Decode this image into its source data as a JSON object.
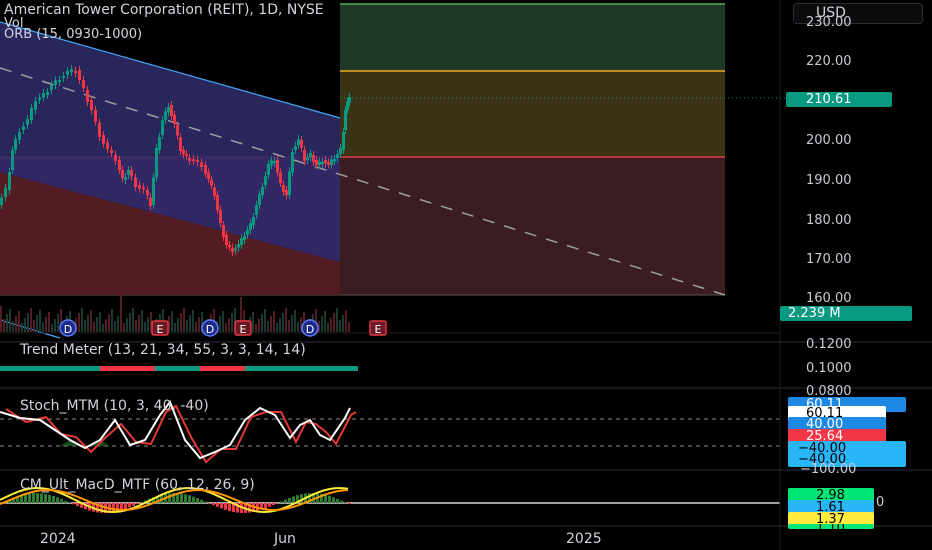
{
  "header": {
    "symbol_title": "American Tower Corporation (REIT), 1D, NYSE",
    "vol_label": "Vol",
    "orb_label": "ORB (15, 0930-1000)",
    "currency": "USD"
  },
  "price_axis": {
    "ticks": [
      "230.00",
      "220.00",
      "210.00",
      "200.00",
      "190.00",
      "180.00",
      "170.00",
      "160.00"
    ],
    "last_price": "210.61",
    "volume_badge": "2.239 M"
  },
  "trend_meter": {
    "title": "Trend Meter (13, 21, 34, 55, 3, 3, 14, 14)",
    "ticks": [
      "0.1200",
      "0.1000",
      "0.0800"
    ]
  },
  "stoch_mtm": {
    "title": "Stoch_MTM (10, 3, 40, -40)",
    "badges": [
      "60.11",
      "60.11",
      "40.00",
      "25.64",
      "−40.00",
      "−40.00",
      "−100.00"
    ]
  },
  "macd": {
    "title": "CM_Ult_MacD_MTF (60, 12, 26, 9)",
    "badges": [
      "2.98",
      "1.61",
      "1.37",
      "1.10"
    ],
    "zero_tick": "0"
  },
  "time_axis": {
    "labels": [
      "2024",
      "Jun",
      "2025"
    ]
  },
  "events": [
    "D",
    "E",
    "D",
    "E",
    "D",
    "E"
  ],
  "colors": {
    "green": "#089981",
    "red": "#f23645",
    "blue_badge": "#2962ff",
    "last_price_bg": "#089981"
  }
}
